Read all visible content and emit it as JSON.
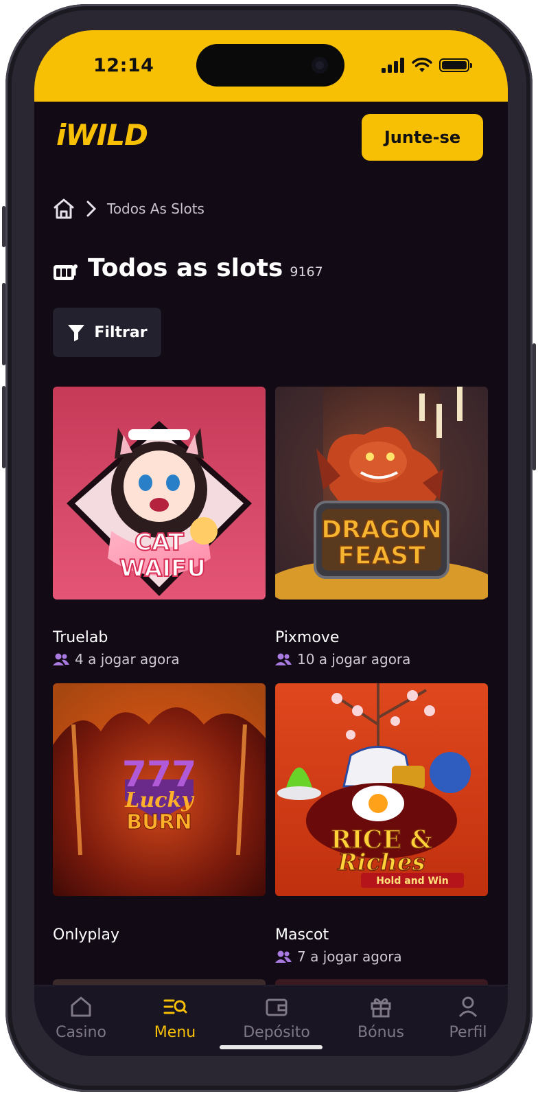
{
  "status_bar": {
    "time": "12:14"
  },
  "header": {
    "logo": "iWILD",
    "join_label": "Junte-se"
  },
  "breadcrumb": {
    "current": "Todos As Slots"
  },
  "section": {
    "title": "Todos as slots",
    "count": "9167",
    "filter_label": "Filtrar"
  },
  "games": [
    {
      "art_title": "CAT WAIFU",
      "provider": "Truelab",
      "players": "4 a jogar agora"
    },
    {
      "art_title": "DRAGON FEAST",
      "provider": "Pixmove",
      "players": "10 a jogar agora"
    },
    {
      "art_title": "Lucky BURN",
      "provider": "Onlyplay",
      "players": ""
    },
    {
      "art_title": "RICE & RICHES",
      "art_subtitle": "Hold and Win",
      "provider": "Mascot",
      "players": "7 a jogar agora"
    }
  ],
  "bottom_nav": [
    {
      "label": "Casino",
      "icon": "home-icon",
      "active": false
    },
    {
      "label": "Menu",
      "icon": "menu-search-icon",
      "active": true
    },
    {
      "label": "Depósito",
      "icon": "wallet-icon",
      "active": false
    },
    {
      "label": "Bónus",
      "icon": "gift-icon",
      "active": false
    },
    {
      "label": "Perfil",
      "icon": "user-icon",
      "active": false
    }
  ],
  "colors": {
    "accent": "#f8c005",
    "background": "#120a15",
    "player_icon": "#a97be0"
  }
}
